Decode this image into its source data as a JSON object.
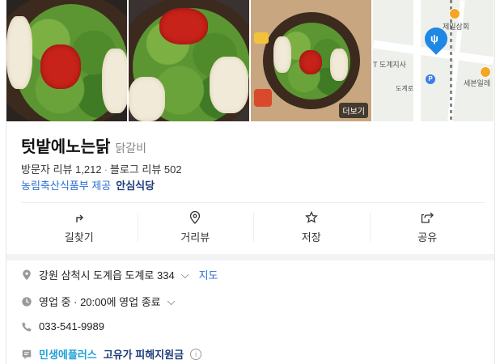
{
  "photos": {
    "more_label": "더보기"
  },
  "map": {
    "labels": [
      "제일삼회",
      "T 도계지사",
      "도계로",
      "세븐일레"
    ]
  },
  "place": {
    "name": "텃밭에노는닭",
    "category": "닭갈비",
    "visitor_reviews": "방문자 리뷰 1,212",
    "blog_reviews": "블로그 리뷰 502",
    "provider": "농림축산식품부 제공",
    "badge": "안심식당"
  },
  "actions": [
    {
      "label": "길찾기",
      "icon": "directions-icon"
    },
    {
      "label": "거리뷰",
      "icon": "pin-icon"
    },
    {
      "label": "저장",
      "icon": "star-icon"
    },
    {
      "label": "공유",
      "icon": "share-icon"
    }
  ],
  "details": {
    "address": "강원 삼척시 도계읍 도계로 334",
    "map_link": "지도",
    "hours_status": "영업 중",
    "hours_text": "· 20:00에 영업 종료",
    "phone": "033-541-9989",
    "promo_brand": "민생에플러스",
    "promo_text": "고유가 피해지원금"
  },
  "colors": {
    "link": "#2b6fd0",
    "map_pin": "#1e88e5",
    "promo": "#1fa0d8"
  }
}
